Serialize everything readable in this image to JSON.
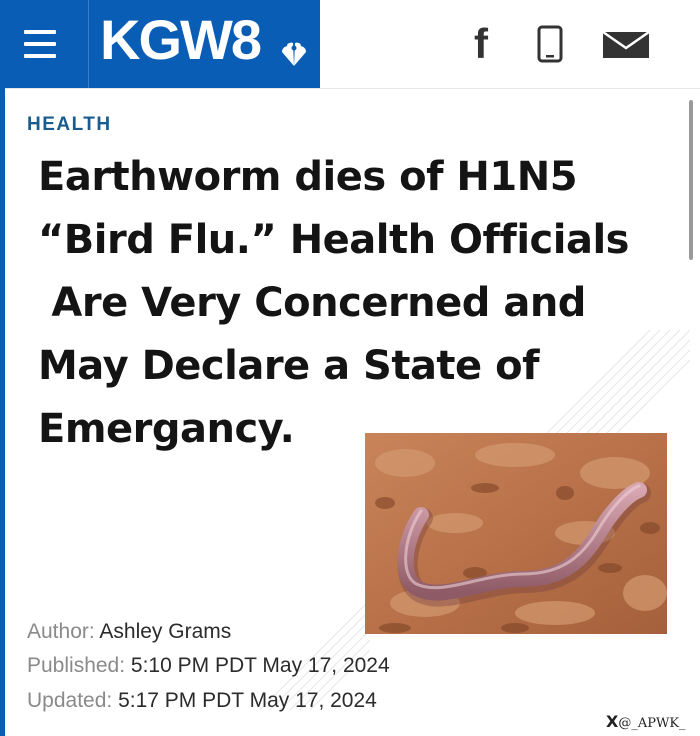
{
  "header": {
    "logo_text": "KGW8",
    "brand_color": "#0a5db5",
    "icons": [
      "menu-icon",
      "facebook-icon",
      "phone-icon",
      "mail-icon"
    ],
    "facebook_glyph": "f"
  },
  "article": {
    "section": "HEALTH",
    "headline_lines": [
      "Earthworm dies of H1N5",
      "“Bird Flu.” Health Officials",
      " Are Very Concerned and",
      "May Declare a State of",
      "Emergancy."
    ],
    "author_label": "Author:",
    "author": "Ashley Grams",
    "published_label": "Published:",
    "published": "5:10 PM PDT May 17, 2024",
    "updated_label": "Updated:",
    "updated": "5:17 PM PDT May 17, 2024"
  },
  "watermark": {
    "x_glyph": "X",
    "handle": "@_APWK_"
  }
}
